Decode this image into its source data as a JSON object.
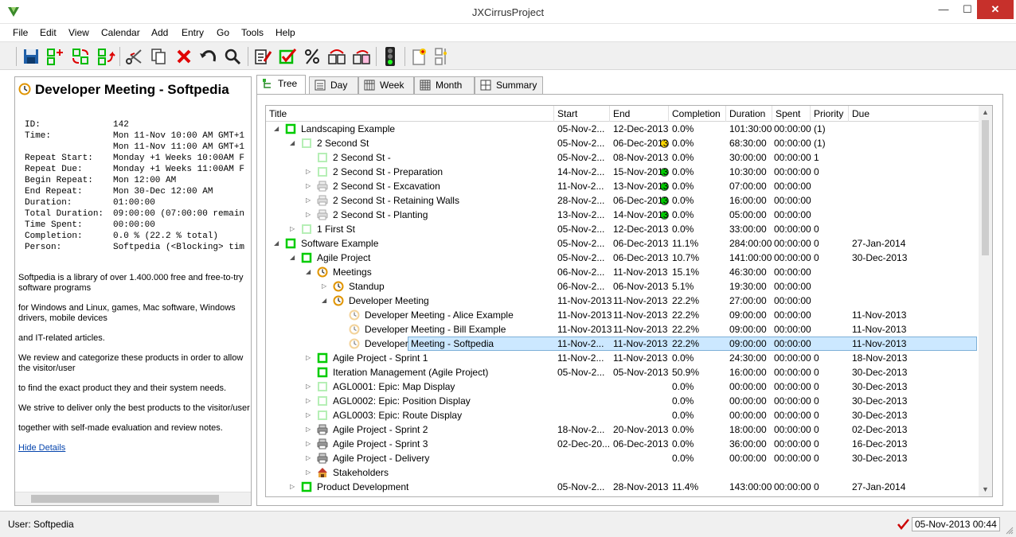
{
  "window": {
    "title": "JXCirrusProject",
    "minimize": "—",
    "maximize": "☐",
    "close": "✕"
  },
  "menu": [
    "File",
    "Edit",
    "View",
    "Calendar",
    "Add",
    "Entry",
    "Go",
    "Tools",
    "Help"
  ],
  "toolbar": {
    "icons": [
      "save-icon",
      "add-child-icon",
      "move-icon",
      "move-up-icon",
      "cut-icon",
      "copy-icon",
      "delete-icon",
      "undo-icon",
      "search-icon",
      "edit-icon",
      "complete-icon",
      "percent-icon",
      "schedule-icon",
      "reschedule-icon",
      "traffic-light-icon",
      "new-note-icon",
      "split-icon"
    ]
  },
  "details": {
    "title": "Developer Meeting - Softpedia",
    "attributes": [
      {
        "key": "ID:",
        "value": "142"
      },
      {
        "key": "Time:",
        "value": "Mon 11-Nov 10:00 AM GMT+1"
      },
      {
        "key": "",
        "value": "Mon 11-Nov 11:00 AM GMT+1"
      },
      {
        "key": "Repeat Start:",
        "value": "Monday +1 Weeks 10:00AM F"
      },
      {
        "key": "Repeat Due:",
        "value": "Monday +1 Weeks 11:00AM F"
      },
      {
        "key": "Begin Repeat:",
        "value": "Mon 12:00 AM"
      },
      {
        "key": "End Repeat:",
        "value": "Mon 30-Dec 12:00 AM"
      },
      {
        "key": "Duration:",
        "value": "01:00:00"
      },
      {
        "key": "Total Duration:",
        "value": "09:00:00 (07:00:00 remain"
      },
      {
        "key": "Time Spent:",
        "value": "00:00:00"
      },
      {
        "key": "Completion:",
        "value": "0.0 % (22.2 % total)"
      },
      {
        "key": "Person:",
        "value": "Softpedia (<Blocking> tim"
      }
    ],
    "description": [
      "Softpedia is a library of over 1.400.000 free and free-to-try software programs",
      "for Windows and Linux, games, Mac software, Windows drivers, mobile devices",
      "and IT-related articles.",
      "We review and categorize these products in order to allow the visitor/user",
      "to find the exact product they and their system needs.",
      "We strive to deliver only the best products to the visitor/user",
      "together with self-made evaluation and review notes."
    ],
    "hide_link": "Hide Details"
  },
  "tabs": [
    "Tree",
    "Day",
    "Week",
    "Month",
    "Summary"
  ],
  "columns": [
    "Title",
    "Start",
    "End",
    "Completion",
    "Duration",
    "Spent",
    "Priority",
    "Due"
  ],
  "rows": [
    {
      "level": 0,
      "toggle": "open",
      "icon": "green",
      "title": "Landscaping Example",
      "start": "05-Nov-2...",
      "end": "12-Dec-2013",
      "dot": "",
      "completion": "0.0%",
      "duration": "101:30:00",
      "spent": "00:00:00",
      "priority": "(1)",
      "due": ""
    },
    {
      "level": 1,
      "toggle": "open",
      "icon": "light",
      "title": "2 Second St",
      "start": "05-Nov-2...",
      "end": "06-Dec-2013",
      "dot": "yellow",
      "completion": "0.0%",
      "duration": "68:30:00",
      "spent": "00:00:00",
      "priority": "(1)",
      "due": ""
    },
    {
      "level": 2,
      "toggle": "",
      "icon": "light",
      "title": "2 Second St -",
      "start": "05-Nov-2...",
      "end": "08-Nov-2013",
      "dot": "",
      "completion": "0.0%",
      "duration": "30:00:00",
      "spent": "00:00:00",
      "priority": "1",
      "due": ""
    },
    {
      "level": 2,
      "toggle": "closed",
      "icon": "light",
      "title": "2 Second St - Preparation",
      "start": "14-Nov-2...",
      "end": "15-Nov-2013",
      "dot": "green",
      "completion": "0.0%",
      "duration": "10:30:00",
      "spent": "00:00:00",
      "priority": "0",
      "due": ""
    },
    {
      "level": 2,
      "toggle": "closed",
      "icon": "printer",
      "title": "2 Second St - Excavation",
      "start": "11-Nov-2...",
      "end": "13-Nov-2013",
      "dot": "green",
      "completion": "0.0%",
      "duration": "07:00:00",
      "spent": "00:00:00",
      "priority": "",
      "due": ""
    },
    {
      "level": 2,
      "toggle": "closed",
      "icon": "printer",
      "title": "2 Second St - Retaining Walls",
      "start": "28-Nov-2...",
      "end": "06-Dec-2013",
      "dot": "green",
      "completion": "0.0%",
      "duration": "16:00:00",
      "spent": "00:00:00",
      "priority": "",
      "due": ""
    },
    {
      "level": 2,
      "toggle": "closed",
      "icon": "printer",
      "title": "2 Second St - Planting",
      "start": "13-Nov-2...",
      "end": "14-Nov-2013",
      "dot": "green",
      "completion": "0.0%",
      "duration": "05:00:00",
      "spent": "00:00:00",
      "priority": "",
      "due": ""
    },
    {
      "level": 1,
      "toggle": "closed",
      "icon": "light",
      "title": "1 First St",
      "start": "05-Nov-2...",
      "end": "12-Dec-2013",
      "dot": "",
      "completion": "0.0%",
      "duration": "33:00:00",
      "spent": "00:00:00",
      "priority": "0",
      "due": ""
    },
    {
      "level": 0,
      "toggle": "open",
      "icon": "green",
      "title": "Software Example",
      "start": "05-Nov-2...",
      "end": "06-Dec-2013",
      "dot": "",
      "completion": "11.1%",
      "duration": "284:00:00",
      "spent": "00:00:00",
      "priority": "0",
      "due": "27-Jan-2014"
    },
    {
      "level": 1,
      "toggle": "open",
      "icon": "green",
      "title": "Agile Project",
      "start": "05-Nov-2...",
      "end": "06-Dec-2013",
      "dot": "",
      "completion": "10.7%",
      "duration": "141:00:00",
      "spent": "00:00:00",
      "priority": "0",
      "due": "30-Dec-2013"
    },
    {
      "level": 2,
      "toggle": "open",
      "icon": "clock",
      "title": "Meetings",
      "start": "06-Nov-2...",
      "end": "11-Nov-2013",
      "dot": "",
      "completion": "15.1%",
      "duration": "46:30:00",
      "spent": "00:00:00",
      "priority": "",
      "due": ""
    },
    {
      "level": 3,
      "toggle": "closed",
      "icon": "clock",
      "title": "Standup",
      "start": "06-Nov-2...",
      "end": "06-Nov-2013",
      "dot": "",
      "completion": "5.1%",
      "duration": "19:30:00",
      "spent": "00:00:00",
      "priority": "",
      "due": ""
    },
    {
      "level": 3,
      "toggle": "open",
      "icon": "clock",
      "title": "Developer Meeting",
      "start": "11-Nov-2013",
      "end": "11-Nov-2013",
      "dot": "",
      "completion": "22.2%",
      "duration": "27:00:00",
      "spent": "00:00:00",
      "priority": "",
      "due": ""
    },
    {
      "level": 4,
      "toggle": "",
      "icon": "clock-light",
      "title": "Developer Meeting - Alice Example",
      "start": "11-Nov-2013",
      "end": "11-Nov-2013",
      "dot": "",
      "completion": "22.2%",
      "duration": "09:00:00",
      "spent": "00:00:00",
      "priority": "",
      "due": "11-Nov-2013"
    },
    {
      "level": 4,
      "toggle": "",
      "icon": "clock-light",
      "title": "Developer Meeting - Bill Example",
      "start": "11-Nov-2013",
      "end": "11-Nov-2013",
      "dot": "",
      "completion": "22.2%",
      "duration": "09:00:00",
      "spent": "00:00:00",
      "priority": "",
      "due": "11-Nov-2013"
    },
    {
      "level": 4,
      "toggle": "",
      "icon": "clock-light",
      "title": "Developer Meeting - Softpedia",
      "start": "11-Nov-2...",
      "end": "11-Nov-2013",
      "dot": "",
      "completion": "22.2%",
      "duration": "09:00:00",
      "spent": "00:00:00",
      "priority": "",
      "due": "11-Nov-2013",
      "selected": true
    },
    {
      "level": 2,
      "toggle": "closed",
      "icon": "green",
      "title": "Agile Project - Sprint 1",
      "start": "11-Nov-2...",
      "end": "11-Nov-2013",
      "dot": "",
      "completion": "0.0%",
      "duration": "24:30:00",
      "spent": "00:00:00",
      "priority": "0",
      "due": "18-Nov-2013"
    },
    {
      "level": 2,
      "toggle": "",
      "icon": "green",
      "title": "Iteration Management (Agile Project)",
      "start": "05-Nov-2...",
      "end": "05-Nov-2013",
      "dot": "",
      "completion": "50.9%",
      "duration": "16:00:00",
      "spent": "00:00:00",
      "priority": "0",
      "due": "30-Dec-2013"
    },
    {
      "level": 2,
      "toggle": "closed",
      "icon": "light",
      "title": "AGL0001: Epic: Map Display",
      "start": "",
      "end": "",
      "dot": "",
      "completion": "0.0%",
      "duration": "00:00:00",
      "spent": "00:00:00",
      "priority": "0",
      "due": "30-Dec-2013"
    },
    {
      "level": 2,
      "toggle": "closed",
      "icon": "light",
      "title": "AGL0002: Epic: Position Display",
      "start": "",
      "end": "",
      "dot": "",
      "completion": "0.0%",
      "duration": "00:00:00",
      "spent": "00:00:00",
      "priority": "0",
      "due": "30-Dec-2013"
    },
    {
      "level": 2,
      "toggle": "closed",
      "icon": "light",
      "title": "AGL0003: Epic: Route Display",
      "start": "",
      "end": "",
      "dot": "",
      "completion": "0.0%",
      "duration": "00:00:00",
      "spent": "00:00:00",
      "priority": "0",
      "due": "30-Dec-2013"
    },
    {
      "level": 2,
      "toggle": "closed",
      "icon": "printer-dark",
      "title": "Agile Project - Sprint 2",
      "start": "18-Nov-2...",
      "end": "20-Nov-2013",
      "dot": "",
      "completion": "0.0%",
      "duration": "18:00:00",
      "spent": "00:00:00",
      "priority": "0",
      "due": "02-Dec-2013"
    },
    {
      "level": 2,
      "toggle": "closed",
      "icon": "printer-dark",
      "title": "Agile Project - Sprint 3",
      "start": "02-Dec-20...",
      "end": "06-Dec-2013",
      "dot": "",
      "completion": "0.0%",
      "duration": "36:00:00",
      "spent": "00:00:00",
      "priority": "0",
      "due": "16-Dec-2013"
    },
    {
      "level": 2,
      "toggle": "closed",
      "icon": "printer-dark",
      "title": "Agile Project - Delivery",
      "start": "",
      "end": "",
      "dot": "",
      "completion": "0.0%",
      "duration": "00:00:00",
      "spent": "00:00:00",
      "priority": "0",
      "due": "30-Dec-2013"
    },
    {
      "level": 2,
      "toggle": "closed",
      "icon": "house",
      "title": "Stakeholders",
      "start": "",
      "end": "",
      "dot": "",
      "completion": "",
      "duration": "",
      "spent": "",
      "priority": "",
      "due": ""
    },
    {
      "level": 1,
      "toggle": "closed",
      "icon": "green",
      "title": "Product Development",
      "start": "05-Nov-2...",
      "end": "28-Nov-2013",
      "dot": "",
      "completion": "11.4%",
      "duration": "143:00:00",
      "spent": "00:00:00",
      "priority": "0",
      "due": "27-Jan-2014"
    }
  ],
  "status": {
    "user": "User: Softpedia",
    "datetime": "05-Nov-2013 00:44"
  },
  "colors": {
    "green": "#00cc00",
    "yellow": "#ffd700",
    "selection": "#cce8ff"
  }
}
